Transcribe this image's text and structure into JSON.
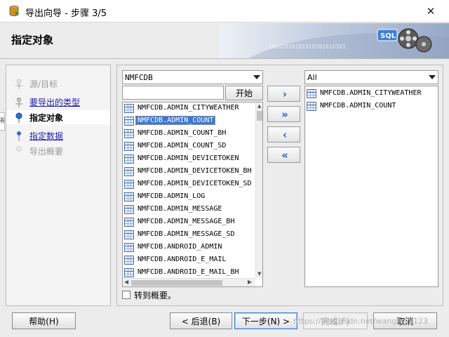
{
  "window": {
    "title": "导出向导 - 步骤 3/5",
    "close_glyph": "✕"
  },
  "banner": {
    "title": "指定对象",
    "image_text": "10101010101010101010101",
    "image_badge": "SQL"
  },
  "steps": [
    {
      "label": "源/目标",
      "state": "done"
    },
    {
      "label": "要导出的类型",
      "state": "link"
    },
    {
      "label": "指定对象",
      "state": "current"
    },
    {
      "label": "指定数据",
      "state": "link"
    },
    {
      "label": "导出概要",
      "state": "future"
    }
  ],
  "left_edge_clip": "裲",
  "main": {
    "schema_combo": {
      "selected": "NMFCDB"
    },
    "filter": {
      "value": "",
      "placeholder": ""
    },
    "start_button": "开始",
    "available_objects": [
      "NMFCDB.ADMIN_CITYWEATHER",
      "NMFCDB.ADMIN_COUNT",
      "NMFCDB.ADMIN_COUNT_BH",
      "NMFCDB.ADMIN_COUNT_SD",
      "NMFCDB.ADMIN_DEVICETOKEN",
      "NMFCDB.ADMIN_DEVICETOKEN_BH",
      "NMFCDB.ADMIN_DEVICETOKEN_SD",
      "NMFCDB.ADMIN_LOG",
      "NMFCDB.ADMIN_MESSAGE",
      "NMFCDB.ADMIN_MESSAGE_BH",
      "NMFCDB.ADMIN_MESSAGE_SD",
      "NMFCDB.ANDROID_ADMIN",
      "NMFCDB.ANDROID_E_MAIL",
      "NMFCDB.ANDROID_E_MAIL_BH"
    ],
    "selected_index": 1,
    "move_buttons": {
      "add": "›",
      "add_all": "»",
      "remove": "‹",
      "remove_all": "«"
    },
    "target_combo": {
      "selected": "All"
    },
    "selected_objects": [
      "NMFCDB.ADMIN_CITYWEATHER",
      "NMFCDB.ADMIN_COUNT"
    ],
    "goto_summary": {
      "label": "转到概要。",
      "checked": false
    }
  },
  "buttons": {
    "help": "帮助(H)",
    "back": "< 后退(B)",
    "next": "下一步(N) >",
    "finish": "完成(F)",
    "cancel": "取消"
  },
  "watermark": "https://blog.csdn.net/wangfujia123",
  "colors": {
    "selection": "#3a78d6",
    "link": "#1c1ca8",
    "move_arrow": "#1f5fd0"
  }
}
